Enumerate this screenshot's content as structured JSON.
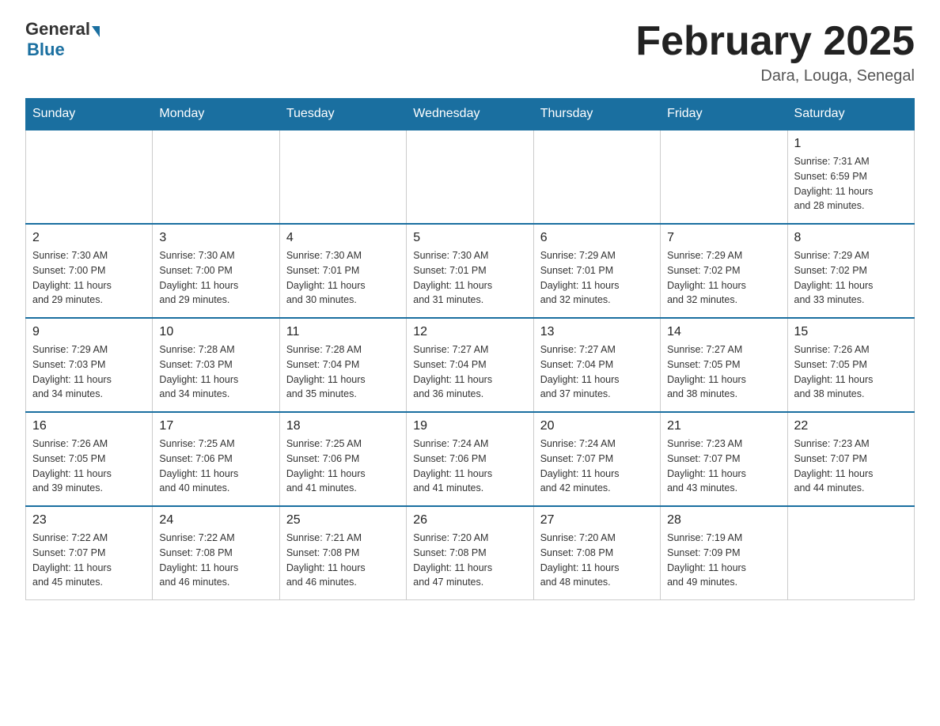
{
  "header": {
    "logo_general": "General",
    "logo_blue": "Blue",
    "month_title": "February 2025",
    "location": "Dara, Louga, Senegal"
  },
  "weekdays": [
    "Sunday",
    "Monday",
    "Tuesday",
    "Wednesday",
    "Thursday",
    "Friday",
    "Saturday"
  ],
  "weeks": [
    [
      {
        "day": "",
        "info": ""
      },
      {
        "day": "",
        "info": ""
      },
      {
        "day": "",
        "info": ""
      },
      {
        "day": "",
        "info": ""
      },
      {
        "day": "",
        "info": ""
      },
      {
        "day": "",
        "info": ""
      },
      {
        "day": "1",
        "info": "Sunrise: 7:31 AM\nSunset: 6:59 PM\nDaylight: 11 hours\nand 28 minutes."
      }
    ],
    [
      {
        "day": "2",
        "info": "Sunrise: 7:30 AM\nSunset: 7:00 PM\nDaylight: 11 hours\nand 29 minutes."
      },
      {
        "day": "3",
        "info": "Sunrise: 7:30 AM\nSunset: 7:00 PM\nDaylight: 11 hours\nand 29 minutes."
      },
      {
        "day": "4",
        "info": "Sunrise: 7:30 AM\nSunset: 7:01 PM\nDaylight: 11 hours\nand 30 minutes."
      },
      {
        "day": "5",
        "info": "Sunrise: 7:30 AM\nSunset: 7:01 PM\nDaylight: 11 hours\nand 31 minutes."
      },
      {
        "day": "6",
        "info": "Sunrise: 7:29 AM\nSunset: 7:01 PM\nDaylight: 11 hours\nand 32 minutes."
      },
      {
        "day": "7",
        "info": "Sunrise: 7:29 AM\nSunset: 7:02 PM\nDaylight: 11 hours\nand 32 minutes."
      },
      {
        "day": "8",
        "info": "Sunrise: 7:29 AM\nSunset: 7:02 PM\nDaylight: 11 hours\nand 33 minutes."
      }
    ],
    [
      {
        "day": "9",
        "info": "Sunrise: 7:29 AM\nSunset: 7:03 PM\nDaylight: 11 hours\nand 34 minutes."
      },
      {
        "day": "10",
        "info": "Sunrise: 7:28 AM\nSunset: 7:03 PM\nDaylight: 11 hours\nand 34 minutes."
      },
      {
        "day": "11",
        "info": "Sunrise: 7:28 AM\nSunset: 7:04 PM\nDaylight: 11 hours\nand 35 minutes."
      },
      {
        "day": "12",
        "info": "Sunrise: 7:27 AM\nSunset: 7:04 PM\nDaylight: 11 hours\nand 36 minutes."
      },
      {
        "day": "13",
        "info": "Sunrise: 7:27 AM\nSunset: 7:04 PM\nDaylight: 11 hours\nand 37 minutes."
      },
      {
        "day": "14",
        "info": "Sunrise: 7:27 AM\nSunset: 7:05 PM\nDaylight: 11 hours\nand 38 minutes."
      },
      {
        "day": "15",
        "info": "Sunrise: 7:26 AM\nSunset: 7:05 PM\nDaylight: 11 hours\nand 38 minutes."
      }
    ],
    [
      {
        "day": "16",
        "info": "Sunrise: 7:26 AM\nSunset: 7:05 PM\nDaylight: 11 hours\nand 39 minutes."
      },
      {
        "day": "17",
        "info": "Sunrise: 7:25 AM\nSunset: 7:06 PM\nDaylight: 11 hours\nand 40 minutes."
      },
      {
        "day": "18",
        "info": "Sunrise: 7:25 AM\nSunset: 7:06 PM\nDaylight: 11 hours\nand 41 minutes."
      },
      {
        "day": "19",
        "info": "Sunrise: 7:24 AM\nSunset: 7:06 PM\nDaylight: 11 hours\nand 41 minutes."
      },
      {
        "day": "20",
        "info": "Sunrise: 7:24 AM\nSunset: 7:07 PM\nDaylight: 11 hours\nand 42 minutes."
      },
      {
        "day": "21",
        "info": "Sunrise: 7:23 AM\nSunset: 7:07 PM\nDaylight: 11 hours\nand 43 minutes."
      },
      {
        "day": "22",
        "info": "Sunrise: 7:23 AM\nSunset: 7:07 PM\nDaylight: 11 hours\nand 44 minutes."
      }
    ],
    [
      {
        "day": "23",
        "info": "Sunrise: 7:22 AM\nSunset: 7:07 PM\nDaylight: 11 hours\nand 45 minutes."
      },
      {
        "day": "24",
        "info": "Sunrise: 7:22 AM\nSunset: 7:08 PM\nDaylight: 11 hours\nand 46 minutes."
      },
      {
        "day": "25",
        "info": "Sunrise: 7:21 AM\nSunset: 7:08 PM\nDaylight: 11 hours\nand 46 minutes."
      },
      {
        "day": "26",
        "info": "Sunrise: 7:20 AM\nSunset: 7:08 PM\nDaylight: 11 hours\nand 47 minutes."
      },
      {
        "day": "27",
        "info": "Sunrise: 7:20 AM\nSunset: 7:08 PM\nDaylight: 11 hours\nand 48 minutes."
      },
      {
        "day": "28",
        "info": "Sunrise: 7:19 AM\nSunset: 7:09 PM\nDaylight: 11 hours\nand 49 minutes."
      },
      {
        "day": "",
        "info": ""
      }
    ]
  ]
}
